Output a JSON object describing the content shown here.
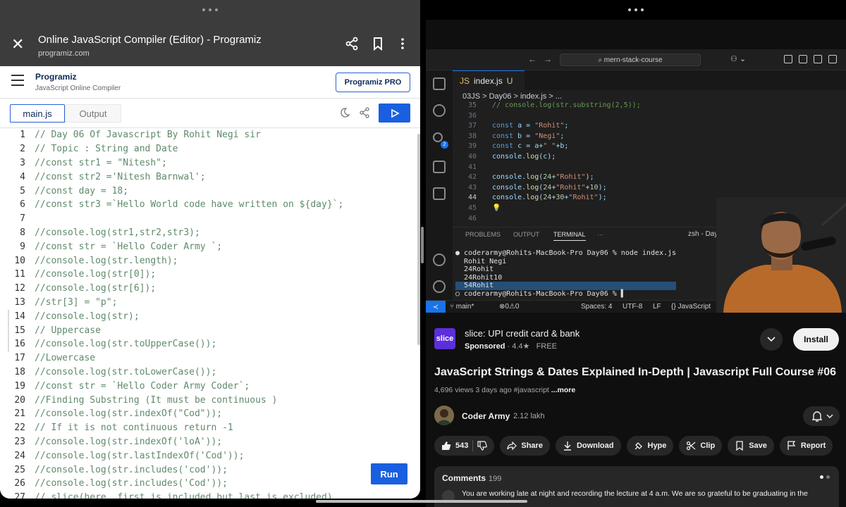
{
  "left": {
    "browser": {
      "title": "Online JavaScript Compiler (Editor) - Programiz",
      "url": "programiz.com"
    },
    "header": {
      "logo": "Programiz",
      "subtitle": "JavaScript Online Compiler",
      "pro_button": "Programiz PRO"
    },
    "tabs": {
      "main": "main.js",
      "output": "Output"
    },
    "run_button": "Run",
    "code_lines": [
      {
        "n": "1",
        "t": "// Day 06 Of Javascript By Rohit Negi sir"
      },
      {
        "n": "2",
        "t": "// Topic : String and Date"
      },
      {
        "n": "3",
        "t": "//const str1 = \"Nitesh\";"
      },
      {
        "n": "4",
        "t": "//const str2 ='Nitesh Barnwal';"
      },
      {
        "n": "5",
        "t": "//const day = 18;"
      },
      {
        "n": "6",
        "t": "//const str3 =`Hello World code have written on ${day}`;"
      },
      {
        "n": "7",
        "t": ""
      },
      {
        "n": "8",
        "t": "//console.log(str1,str2,str3);"
      },
      {
        "n": "9",
        "t": "//const str = `Hello Coder Army `;"
      },
      {
        "n": "10",
        "t": "//console.log(str.length);"
      },
      {
        "n": "11",
        "t": "//console.log(str[0]);"
      },
      {
        "n": "12",
        "t": "//console.log(str[6]);"
      },
      {
        "n": "13",
        "t": "//str[3] = \"p\";"
      },
      {
        "n": "14",
        "t": "//console.log(str);"
      },
      {
        "n": "15",
        "t": "// Uppercase"
      },
      {
        "n": "16",
        "t": "//console.log(str.toUpperCase());"
      },
      {
        "n": "17",
        "t": "//Lowercase"
      },
      {
        "n": "18",
        "t": "//console.log(str.toLowerCase());"
      },
      {
        "n": "19",
        "t": "//const str = `Hello Coder Army Coder`;"
      },
      {
        "n": "20",
        "t": "//Finding Substring (It must be continuous )"
      },
      {
        "n": "21",
        "t": "//console.log(str.indexOf(\"Cod\"));"
      },
      {
        "n": "22",
        "t": "// If it is not continuous return -1"
      },
      {
        "n": "23",
        "t": "//console.log(str.indexOf('loA'));"
      },
      {
        "n": "24",
        "t": "//console.log(str.lastIndexOf('Cod'));"
      },
      {
        "n": "25",
        "t": "//console.log(str.includes('cod'));"
      },
      {
        "n": "26",
        "t": "//console.log(str.includes('Cod'));"
      },
      {
        "n": "27",
        "t": "// slice(here, first is included but last is excluded)"
      }
    ]
  },
  "right": {
    "vscode": {
      "search": "mern-stack-course",
      "tab_file": "index.js",
      "tab_status": "U",
      "breadcrumb": "03JS > Day06 > index.js > ...",
      "code": [
        {
          "n": "35",
          "t": "// console.log(str.substring(2,5));"
        },
        {
          "n": "36",
          "t": ""
        },
        {
          "n": "37",
          "t": "const a = \"Rohit\";"
        },
        {
          "n": "38",
          "t": "const b = \"Negi\";"
        },
        {
          "n": "39",
          "t": "const c = a+\" \"+b;"
        },
        {
          "n": "40",
          "t": "console.log(c);"
        },
        {
          "n": "41",
          "t": ""
        },
        {
          "n": "42",
          "t": "console.log(24+\"Rohit\");"
        },
        {
          "n": "43",
          "t": "console.log(24+\"Rohit\"+10);"
        },
        {
          "n": "44",
          "t": "console.log(24+30+\"Rohit\");"
        },
        {
          "n": "45",
          "t": "💡"
        },
        {
          "n": "46",
          "t": ""
        }
      ],
      "panel_tabs": [
        "PROBLEMS",
        "OUTPUT",
        "TERMINAL",
        "···"
      ],
      "terminal_label": "zsh - Day06",
      "terminal": [
        "● coderarmy@Rohits-MacBook-Pro Day06 % node index.js",
        "  Rohit Negi",
        "  24Rohit",
        "  24Rohit10",
        "  54Rohit",
        "○ coderarmy@Rohits-MacBook-Pro Day06 % ▌"
      ],
      "status": {
        "branch": "main*",
        "problems": "⊗0⚠0",
        "spaces": "Spaces: 4",
        "encoding": "UTF-8",
        "eol": "LF",
        "lang": "{} JavaScript"
      }
    },
    "ad": {
      "logo": "slice",
      "title": "slice: UPI credit card & bank",
      "sponsored": "Sponsored",
      "rating": "· 4.4★",
      "price": "FREE",
      "install": "Install"
    },
    "video": {
      "title": "JavaScript Strings & Dates Explained In-Depth | Javascript Full Course #06",
      "meta": "4,696 views  3 days ago  #javascript",
      "more": "...more",
      "channel": "Coder Army",
      "subs": "2.12 lakh"
    },
    "actions": {
      "likes": "543",
      "share": "Share",
      "download": "Download",
      "hype": "Hype",
      "clip": "Clip",
      "save": "Save",
      "report": "Report"
    },
    "comments": {
      "label": "Comments",
      "count": "199",
      "text": "You are working late at night and recording the lecture at 4 a.m. We are so grateful to be graduating in the"
    }
  }
}
